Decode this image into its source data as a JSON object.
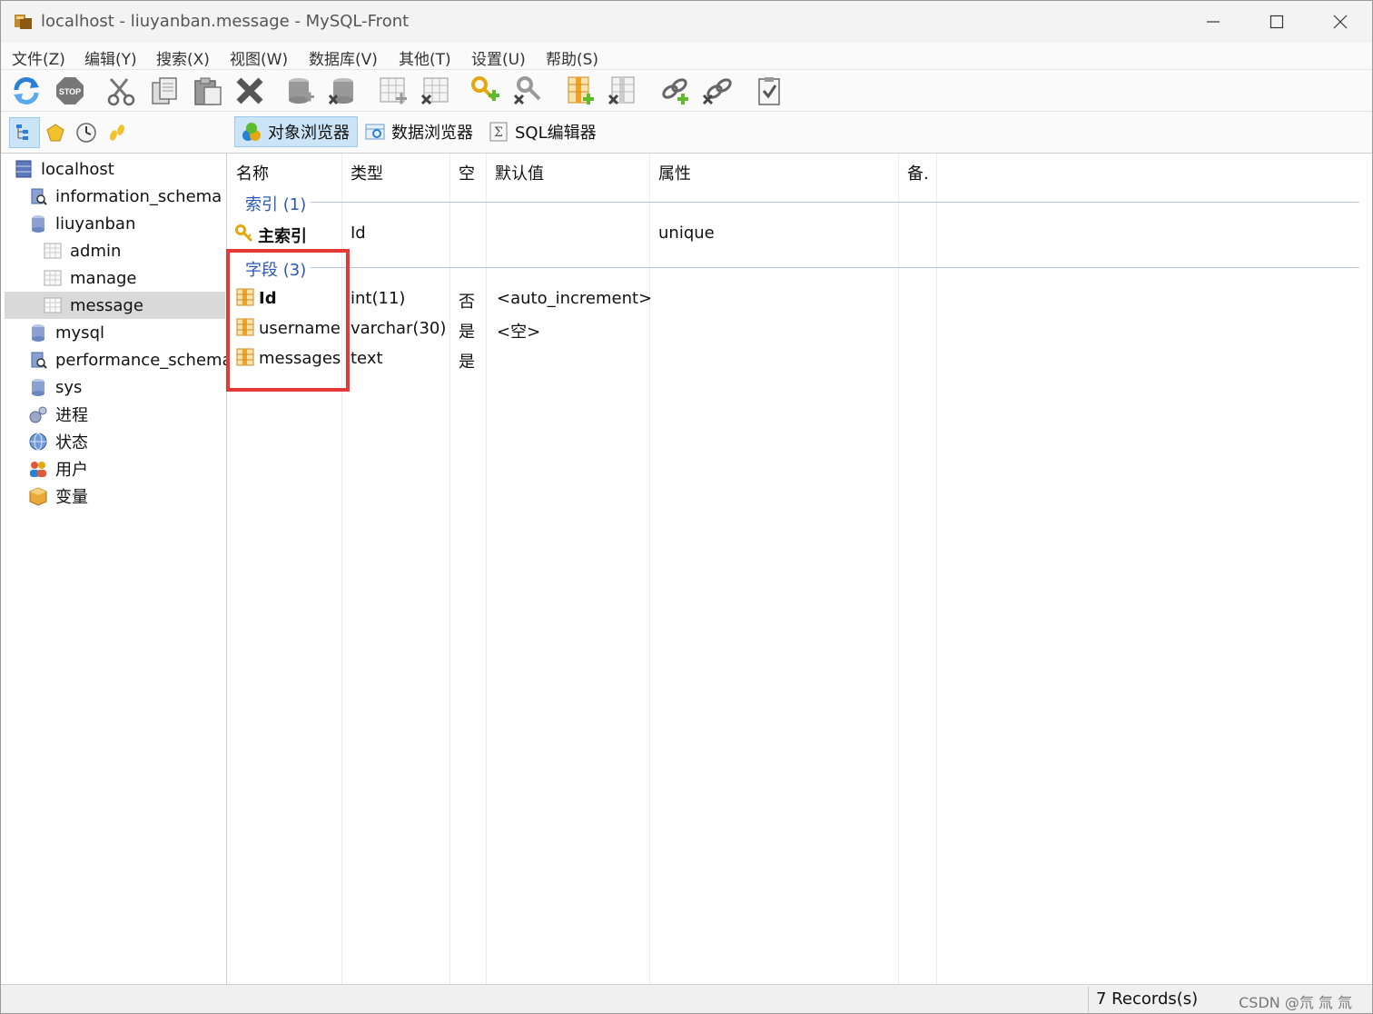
{
  "window": {
    "title": "localhost - liuyanban.message - MySQL-Front"
  },
  "menu": [
    "文件(Z)",
    "编辑(Y)",
    "搜索(X)",
    "视图(W)",
    "数据库(V)",
    "其他(T)",
    "设置(U)",
    "帮助(S)"
  ],
  "toolbar_icons": [
    "refresh-icon",
    "stop-icon",
    "cut-icon",
    "copy-icon",
    "paste-icon",
    "delete-icon",
    "new-database-icon",
    "drop-database-icon",
    "new-table-icon",
    "drop-table-icon",
    "new-index-icon",
    "drop-index-icon",
    "new-field-icon",
    "drop-field-icon",
    "new-foreign-key-icon",
    "drop-foreign-key-icon",
    "properties-icon"
  ],
  "view_tabs": {
    "object_browser": "对象浏览器",
    "data_browser": "数据浏览器",
    "sql_editor": "SQL编辑器"
  },
  "tree": {
    "items": [
      {
        "label": "localhost",
        "icon": "server-icon"
      },
      {
        "label": "information_schema",
        "icon": "system-database-icon"
      },
      {
        "label": "liuyanban",
        "icon": "database-icon"
      },
      {
        "label": "admin",
        "icon": "table-icon"
      },
      {
        "label": "manage",
        "icon": "table-icon"
      },
      {
        "label": "message",
        "icon": "table-icon",
        "selected": true
      },
      {
        "label": "mysql",
        "icon": "database-icon"
      },
      {
        "label": "performance_schema",
        "icon": "system-database-icon"
      },
      {
        "label": "sys",
        "icon": "database-icon"
      },
      {
        "label": "进程",
        "icon": "processes-icon"
      },
      {
        "label": "状态",
        "icon": "status-icon"
      },
      {
        "label": "用户",
        "icon": "users-icon"
      },
      {
        "label": "变量",
        "icon": "variables-icon"
      }
    ]
  },
  "grid": {
    "columns": [
      "名称",
      "类型",
      "空",
      "默认值",
      "属性",
      "备."
    ],
    "index_group": "索引 (1)",
    "indexes": [
      {
        "name": "主索引",
        "type": "Id",
        "attributes": "unique"
      }
    ],
    "field_group": "字段 (3)",
    "fields": [
      {
        "name": "Id",
        "type": "int(11)",
        "null": "否",
        "default": "<auto_increment>"
      },
      {
        "name": "username",
        "type": "varchar(30)",
        "null": "是",
        "default": "<空>"
      },
      {
        "name": "messages",
        "type": "text",
        "null": "是",
        "default": ""
      }
    ]
  },
  "status": {
    "records": "7 Records(s)",
    "watermark": "CSDN @氘 氚 氚"
  },
  "colors": {
    "highlight": "#e53935",
    "group_label": "#2a57b8",
    "selected_tab": "#cce4f7"
  }
}
